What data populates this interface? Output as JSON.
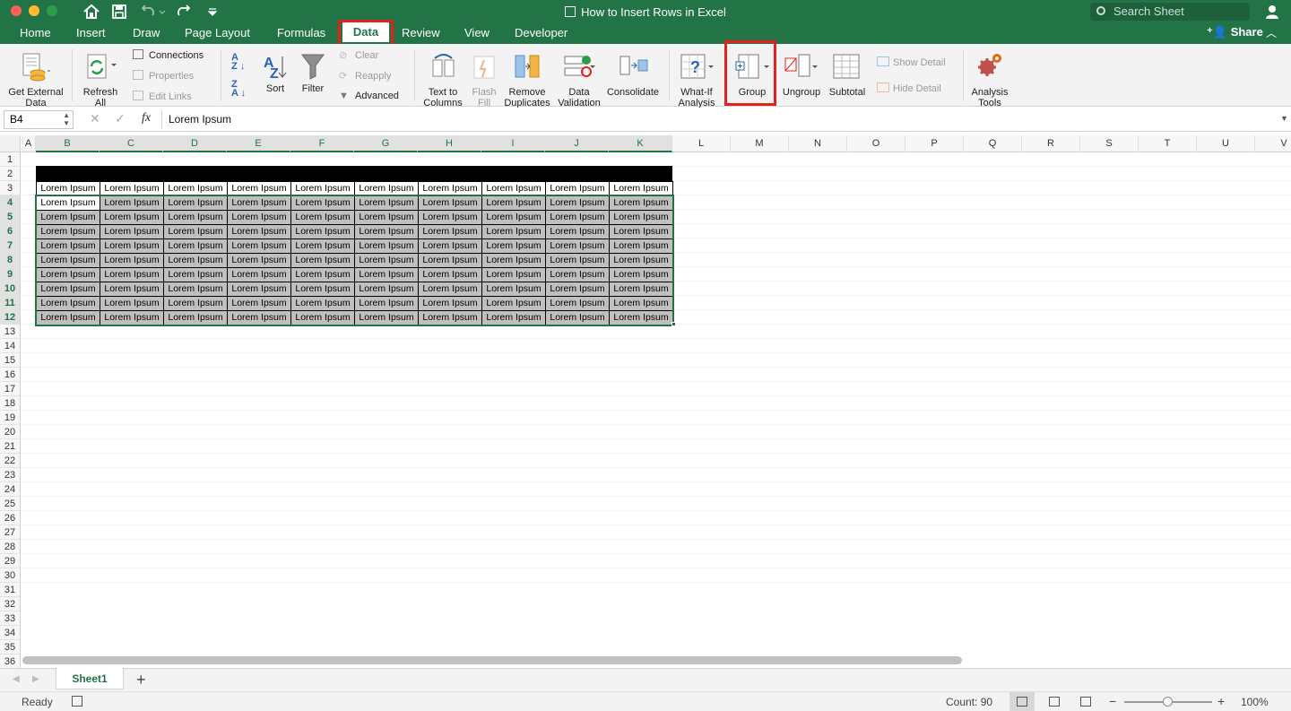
{
  "window": {
    "title": "How to Insert Rows in Excel",
    "search_placeholder": "Search Sheet",
    "share_label": "Share"
  },
  "tabs": [
    "Home",
    "Insert",
    "Draw",
    "Page Layout",
    "Formulas",
    "Data",
    "Review",
    "View",
    "Developer"
  ],
  "active_tab": "Data",
  "ribbon": {
    "get_external_data": "Get External\nData",
    "refresh_all": "Refresh\nAll",
    "connections": "Connections",
    "properties": "Properties",
    "edit_links": "Edit Links",
    "sort": "Sort",
    "filter": "Filter",
    "clear": "Clear",
    "reapply": "Reapply",
    "advanced": "Advanced",
    "text_to_columns": "Text to\nColumns",
    "flash_fill": "Flash\nFill",
    "remove_duplicates": "Remove\nDuplicates",
    "data_validation": "Data\nValidation",
    "consolidate": "Consolidate",
    "what_if": "What-If\nAnalysis",
    "group": "Group",
    "ungroup": "Ungroup",
    "subtotal": "Subtotal",
    "show_detail": "Show Detail",
    "hide_detail": "Hide Detail",
    "analysis_tools": "Analysis\nTools"
  },
  "formula_bar": {
    "name_box": "B4",
    "fx": "fx",
    "formula": "Lorem Ipsum"
  },
  "columns": [
    "A",
    "B",
    "C",
    "D",
    "E",
    "F",
    "G",
    "H",
    "I",
    "J",
    "K",
    "L",
    "M",
    "N",
    "O",
    "P",
    "Q",
    "R",
    "S",
    "T",
    "U",
    "V"
  ],
  "rows": [
    "1",
    "2",
    "3",
    "4",
    "5",
    "6",
    "7",
    "8",
    "9",
    "10",
    "11",
    "12",
    "13",
    "14",
    "15",
    "16",
    "17",
    "18",
    "19",
    "20",
    "21",
    "22",
    "23",
    "24",
    "25",
    "26",
    "27",
    "28",
    "29",
    "30",
    "31",
    "32",
    "33",
    "34",
    "35",
    "36"
  ],
  "cell_text": "Lorem Ipsum",
  "sheet_tab": "Sheet1",
  "add_sheet": "+",
  "status": {
    "ready": "Ready",
    "count": "Count: 90",
    "zoom_minus": "−",
    "zoom_plus": "+",
    "zoom": "100%"
  },
  "colors": {
    "excel_green": "#227447",
    "highlight_red": "#e0241b",
    "selected_fill": "#bfbfbf"
  }
}
